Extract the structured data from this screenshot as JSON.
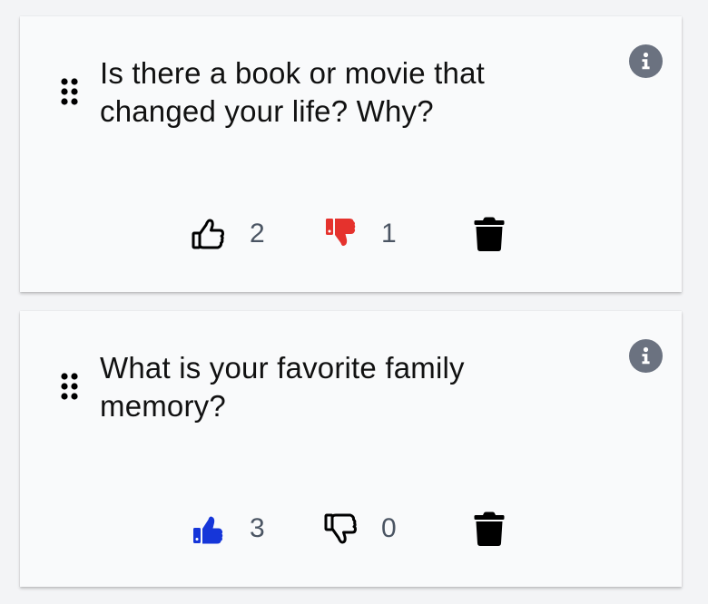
{
  "cards": [
    {
      "question": "Is there a book or movie that changed your life? Why?",
      "upvotes": "2",
      "downvotes": "1",
      "upvote_state": "outline",
      "downvote_state": "active-red",
      "icons": [
        "drag-handle-icon",
        "info-icon",
        "thumbs-up-icon",
        "thumbs-down-icon",
        "trash-icon"
      ]
    },
    {
      "question": "What is your favorite family memory?",
      "upvotes": "3",
      "downvotes": "0",
      "upvote_state": "active-blue",
      "downvote_state": "outline",
      "icons": [
        "drag-handle-icon",
        "info-icon",
        "thumbs-up-icon",
        "thumbs-down-icon",
        "trash-icon"
      ]
    }
  ],
  "colors": {
    "card_background": "#f9fafb",
    "page_background": "#f3f4f6",
    "info_icon": "#6b7280",
    "downvote_active": "#e5322d",
    "upvote_active": "#1636d9",
    "count_text": "#4b5563"
  }
}
